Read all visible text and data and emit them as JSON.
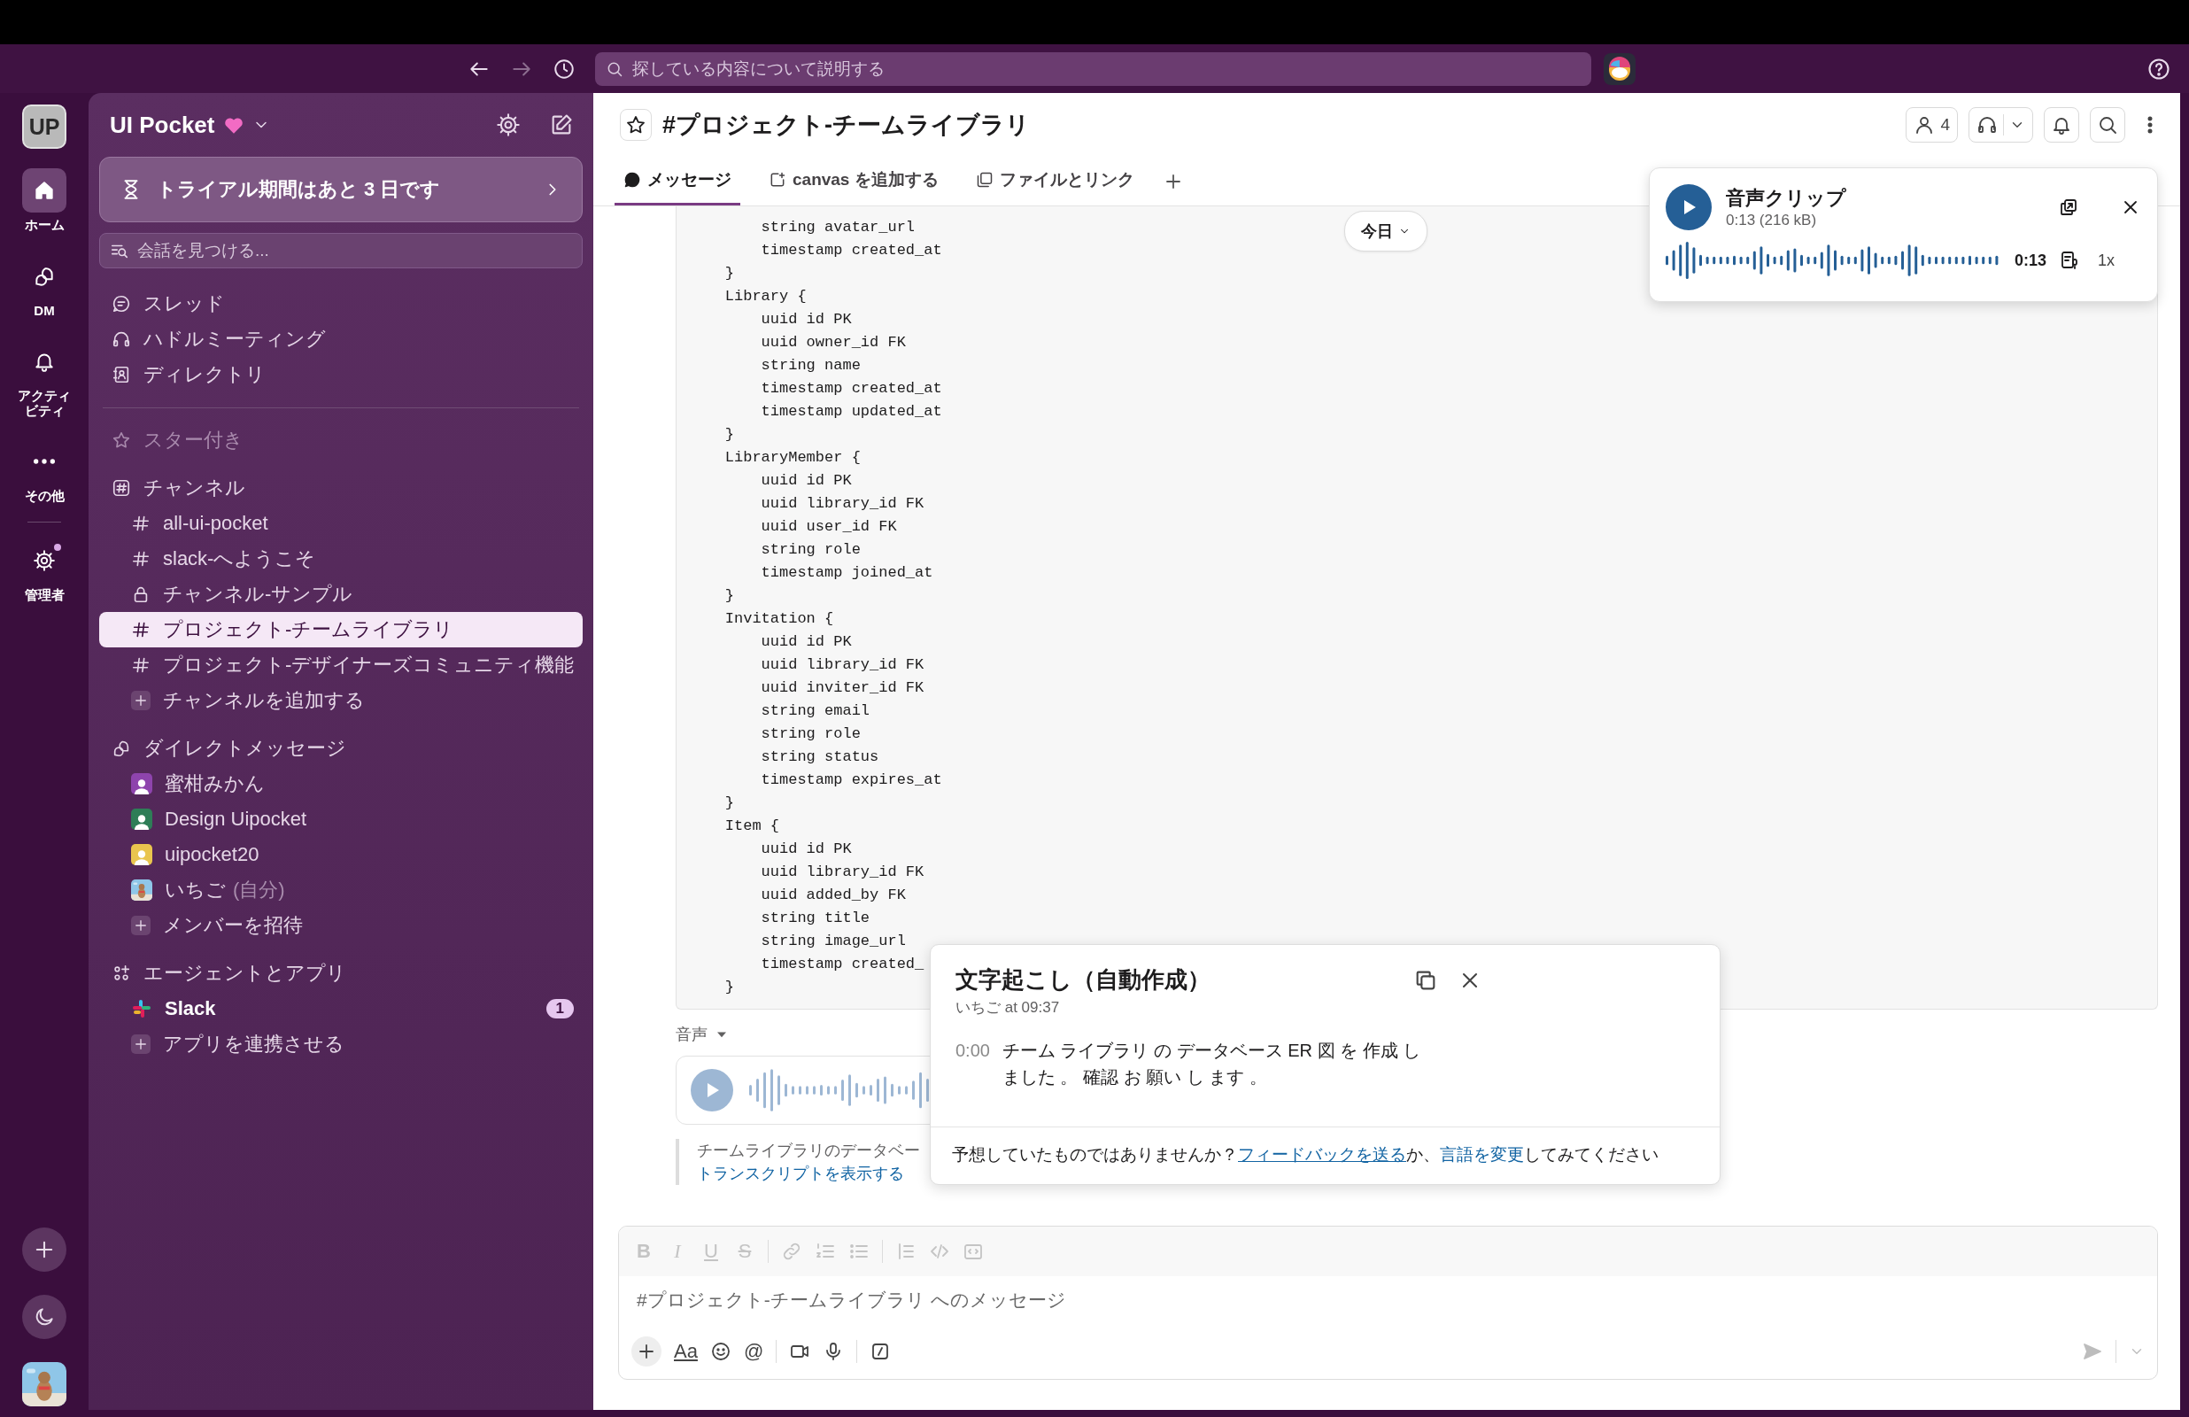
{
  "topbar": {
    "search": {
      "placeholder": "探している内容について説明する"
    }
  },
  "rail": {
    "workspace_initials": "UP",
    "items": [
      {
        "label": "ホーム",
        "kind": "home",
        "selected": true,
        "dot": false
      },
      {
        "label": "DM",
        "kind": "dm",
        "selected": false,
        "dot": false
      },
      {
        "label": "アクティビティ",
        "kind": "activity",
        "selected": false,
        "dot": false
      },
      {
        "label": "その他",
        "kind": "more",
        "selected": false,
        "dot": false
      },
      {
        "label": "管理者",
        "kind": "admin",
        "selected": false,
        "dot": true
      }
    ]
  },
  "sidebar": {
    "workspace": "UI Pocket",
    "trial_banner": "トライアル期間はあと 3 日です",
    "search": {
      "placeholder": "会話を見つける..."
    },
    "nav": [
      {
        "label": "スレッド",
        "kind": "threads"
      },
      {
        "label": "ハドルミーティング",
        "kind": "huddle"
      },
      {
        "label": "ディレクトリ",
        "kind": "directory"
      }
    ],
    "starred": {
      "label": "スター付き"
    },
    "sections": [
      {
        "title": "チャンネル",
        "kind": "channels",
        "items": [
          {
            "label": "all-ui-pocket",
            "kind": "public",
            "selected": false
          },
          {
            "label": "slack-へようこそ",
            "kind": "public",
            "selected": false
          },
          {
            "label": "チャンネル-サンプル",
            "kind": "private",
            "selected": false
          },
          {
            "label": "プロジェクト-チームライブラリ",
            "kind": "public",
            "selected": true
          },
          {
            "label": "プロジェクト-デザイナーズコミュニティ機能",
            "kind": "public",
            "selected": false
          },
          {
            "label": "チャンネルを追加する",
            "kind": "add",
            "selected": false
          }
        ]
      },
      {
        "title": "ダイレクトメッセージ",
        "kind": "dms",
        "items": [
          {
            "label": "蜜柑みかん",
            "kind": "person",
            "color": "#8e44ad",
            "selected": false
          },
          {
            "label": "Design Uipocket",
            "kind": "person",
            "color": "#2e7d57",
            "selected": false
          },
          {
            "label": "uipocket20",
            "kind": "person",
            "color": "#e9c54e",
            "selected": false
          },
          {
            "label": "いちご",
            "note": "(自分)",
            "selected": false
          },
          {
            "label": "メンバーを招待",
            "kind": "add",
            "selected": false
          }
        ]
      },
      {
        "title": "エージェントとアプリ",
        "kind": "apps",
        "items": [
          {
            "label": "Slack",
            "kind": "app",
            "unread": true,
            "badge": "1",
            "selected": false
          },
          {
            "label": "アプリを連携させる",
            "kind": "add",
            "selected": false
          }
        ]
      }
    ]
  },
  "channel": {
    "title": "#プロジェクト-チームライブラリ",
    "member_count": "4",
    "tabs": [
      {
        "label": "メッセージ",
        "kind": "messages",
        "selected": true
      },
      {
        "label": "canvas を追加する",
        "kind": "canvas",
        "selected": false
      },
      {
        "label": "ファイルとリンク",
        "kind": "files",
        "selected": false
      }
    ]
  },
  "messages": {
    "date_divider": "今日",
    "code_lines": [
      "        string avatar_url",
      "        timestamp created_at",
      "    }",
      "    Library {",
      "        uuid id PK",
      "        uuid owner_id FK",
      "        string name",
      "        timestamp created_at",
      "        timestamp updated_at",
      "    }",
      "    LibraryMember {",
      "        uuid id PK",
      "        uuid library_id FK",
      "        uuid user_id FK",
      "        string role",
      "        timestamp joined_at",
      "    }",
      "    Invitation {",
      "        uuid id PK",
      "        uuid library_id FK",
      "        uuid inviter_id FK",
      "        string email",
      "        string role",
      "        string status",
      "        timestamp expires_at",
      "    }",
      "    Item {",
      "        uuid id PK",
      "        uuid library_id FK",
      "        uuid added_by FK",
      "        string title",
      "        string image_url",
      "        timestamp created_",
      "    }"
    ],
    "voice_message": {
      "label": "音声",
      "preview": "チームライブラリのデータベー",
      "show_transcript": "トランスクリプトを表示する"
    }
  },
  "audio_player": {
    "title": "音声クリップ",
    "meta": "0:13 (216 kB)",
    "time": "0:13",
    "speed": "1x"
  },
  "transcript": {
    "title": "文字起こし（自動作成）",
    "byline": "いちご at 09:37",
    "segments": [
      {
        "time": "0:00",
        "text": "チーム ライブラリ の データベース ER 図 を 作成 しました 。 確認 お 願い し ます 。"
      }
    ],
    "footer": [
      {
        "kind": "text",
        "text": "予想していたものではありませんか？"
      },
      {
        "kind": "link",
        "text": "フィードバックを送る"
      },
      {
        "kind": "text",
        "text": "か、"
      },
      {
        "kind": "link",
        "text": "言語を変更"
      },
      {
        "kind": "text",
        "text": "してみてください"
      }
    ]
  },
  "composer": {
    "placeholder": "#プロジェクト-チームライブラリ へのメッセージ",
    "format_tools": [
      {
        "kind": "bold",
        "label": "B",
        "disabled": true
      },
      {
        "kind": "italic",
        "label": "I",
        "disabled": true
      },
      {
        "kind": "underline",
        "label": "U",
        "disabled": true
      },
      {
        "kind": "strike",
        "label": "S",
        "disabled": true
      },
      {
        "kind": "link",
        "disabled": true
      },
      {
        "kind": "ordered",
        "disabled": true
      },
      {
        "kind": "bullet",
        "disabled": true
      },
      {
        "kind": "quote",
        "disabled": true
      },
      {
        "kind": "code",
        "disabled": true
      },
      {
        "kind": "codeblock",
        "disabled": true
      }
    ],
    "actions": [
      {
        "kind": "attach"
      },
      {
        "kind": "format",
        "label": "Aa"
      },
      {
        "kind": "emoji"
      },
      {
        "kind": "mention",
        "label": "@"
      },
      {
        "kind": "video"
      },
      {
        "kind": "audio"
      },
      {
        "kind": "shortcut"
      }
    ]
  }
}
